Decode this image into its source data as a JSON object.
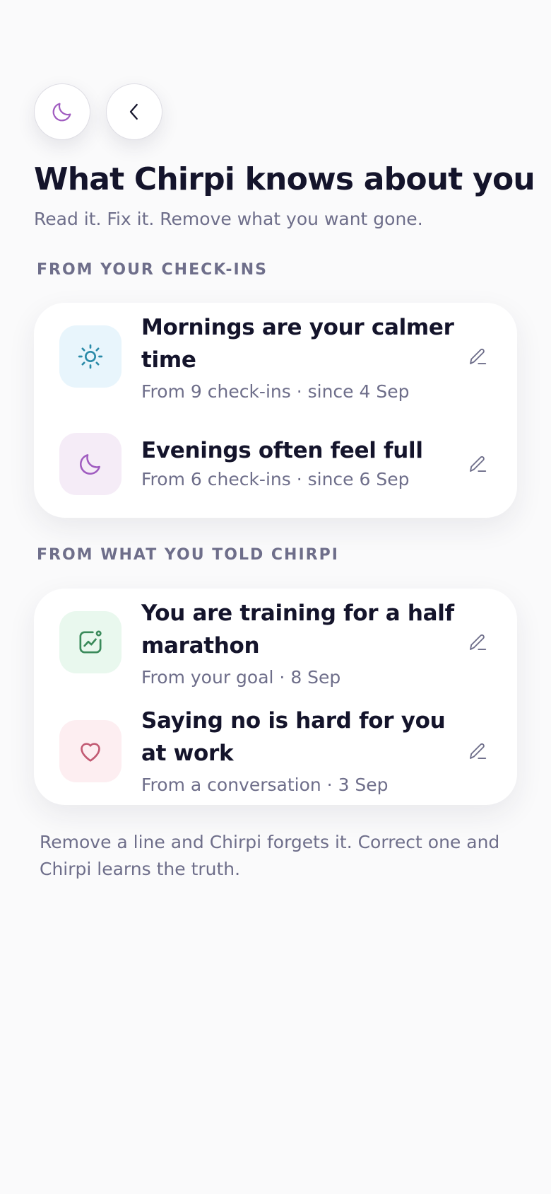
{
  "header": {
    "title": "What Chirpi knows about you",
    "subtitle": "Read it. Fix it. Remove what you want gone."
  },
  "top_buttons": [
    {
      "icon": "moon-icon",
      "color": "#a05cc0"
    },
    {
      "icon": "chevron-left-icon",
      "color": "#14142b"
    }
  ],
  "sections": [
    {
      "label": "FROM YOUR CHECK-INS",
      "items": [
        {
          "icon": "sun-icon",
          "icon_bg": "#e8f5fc",
          "icon_color": "#2a8aa8",
          "title": "Mornings are your calmer time",
          "meta": "From 9 check-ins · since 4 Sep"
        },
        {
          "icon": "moon-icon",
          "icon_bg": "#f5ecf7",
          "icon_color": "#a05cc0",
          "title": "Evenings often feel full",
          "meta": "From 6 check-ins · since 6 Sep"
        }
      ]
    },
    {
      "label": "FROM WHAT YOU TOLD CHIRPI",
      "items": [
        {
          "icon": "trend-chart-icon",
          "icon_bg": "#e9f8ee",
          "icon_color": "#3a8a5a",
          "title": "You are training for a half marathon",
          "meta": "From your goal · 8 Sep"
        },
        {
          "icon": "heart-icon",
          "icon_bg": "#fdeef1",
          "icon_color": "#c25a73",
          "title": "Saying no is hard for you at work",
          "meta": "From a conversation · 3 Sep"
        }
      ]
    }
  ],
  "footer": {
    "note": "Remove a line and Chirpi forgets it. Correct one and Chirpi learns the truth."
  }
}
